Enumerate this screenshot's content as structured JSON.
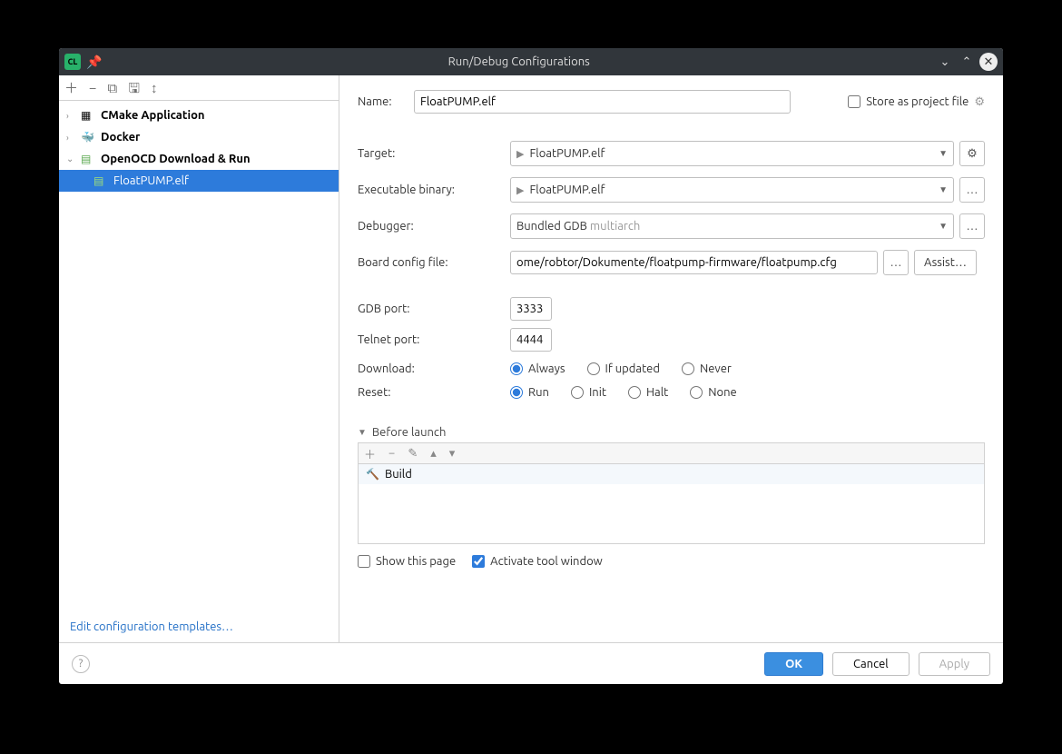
{
  "window": {
    "title": "Run/Debug Configurations"
  },
  "tree": {
    "cmake": "CMake Application",
    "docker": "Docker",
    "openocd": "OpenOCD Download & Run",
    "selected": "FloatPUMP.elf"
  },
  "editLink": "Edit configuration templates…",
  "form": {
    "nameLabel": "Name:",
    "nameValue": "FloatPUMP.elf",
    "storeLabel": "Store as project file",
    "targetLabel": "Target:",
    "targetValue": "FloatPUMP.elf",
    "execLabel": "Executable binary:",
    "execValue": "FloatPUMP.elf",
    "debuggerLabel": "Debugger:",
    "debuggerValue": "Bundled GDB",
    "debuggerExtra": "multiarch",
    "boardLabel": "Board config file:",
    "boardValue": "ome/robtor/Dokumente/floatpump-firmware/floatpump.cfg",
    "assist": "Assist…",
    "gdbPortLabel": "GDB port:",
    "gdbPortValue": "3333",
    "telnetLabel": "Telnet port:",
    "telnetValue": "4444",
    "downloadLabel": "Download:",
    "dl_always": "Always",
    "dl_ifupdated": "If updated",
    "dl_never": "Never",
    "resetLabel": "Reset:",
    "r_run": "Run",
    "r_init": "Init",
    "r_halt": "Halt",
    "r_none": "None",
    "beforeLaunch": "Before launch",
    "buildItem": "Build",
    "showPage": "Show this page",
    "activateTool": "Activate tool window"
  },
  "footer": {
    "ok": "OK",
    "cancel": "Cancel",
    "apply": "Apply"
  }
}
